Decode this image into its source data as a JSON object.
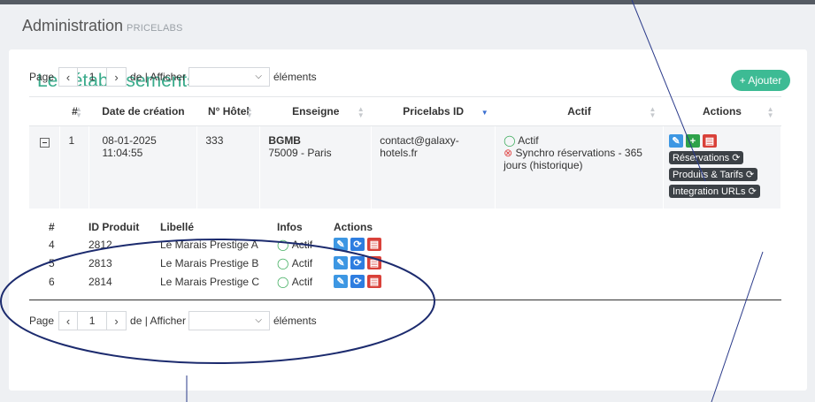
{
  "header": {
    "title": "Administration",
    "subtitle": "PRICELABS"
  },
  "card": {
    "title": "Les établissements",
    "add_label": "+ Ajouter"
  },
  "pagination": {
    "page_label": "Page",
    "current_page": "1",
    "of_label": "de | Afficher",
    "per_page_value": "",
    "items_label": "éléments",
    "prev_icon": "‹",
    "next_icon": "›"
  },
  "table": {
    "columns": [
      "",
      "#",
      "Date de création",
      "N° Hôtel",
      "Enseigne",
      "Pricelabs ID",
      "Actif",
      "Actions"
    ],
    "rows": [
      {
        "index": "1",
        "date": "08-01-2025",
        "time": "11:04:55",
        "hotel_no": "333",
        "brand": "BGMB",
        "brand_city": "75009 - Paris",
        "pricelabs_id_line1": "contact@galaxy-",
        "pricelabs_id_line2": "hotels.fr",
        "status_active": "Actif",
        "status_sync_line1": "Synchro réservations - 365",
        "status_sync_line2": "jours (historique)",
        "tags": [
          "Réservations",
          "Produits & Tarifs",
          "Integration URLs"
        ]
      }
    ]
  },
  "sub_table": {
    "columns": [
      "#",
      "ID Produit",
      "Libellé",
      "Infos",
      "Actions"
    ],
    "rows": [
      {
        "n": "4",
        "id": "2812",
        "label": "Le Marais Prestige A",
        "info": "Actif"
      },
      {
        "n": "5",
        "id": "2813",
        "label": "Le Marais Prestige B",
        "info": "Actif"
      },
      {
        "n": "6",
        "id": "2814",
        "label": "Le Marais Prestige C",
        "info": "Actif"
      }
    ]
  },
  "colors": {
    "accent": "#3aab8b",
    "add_button": "#3dbb94",
    "ok": "#3aab5a",
    "error": "#e04848",
    "tag": "#3c4146",
    "annotation": "#1c2b6e"
  }
}
